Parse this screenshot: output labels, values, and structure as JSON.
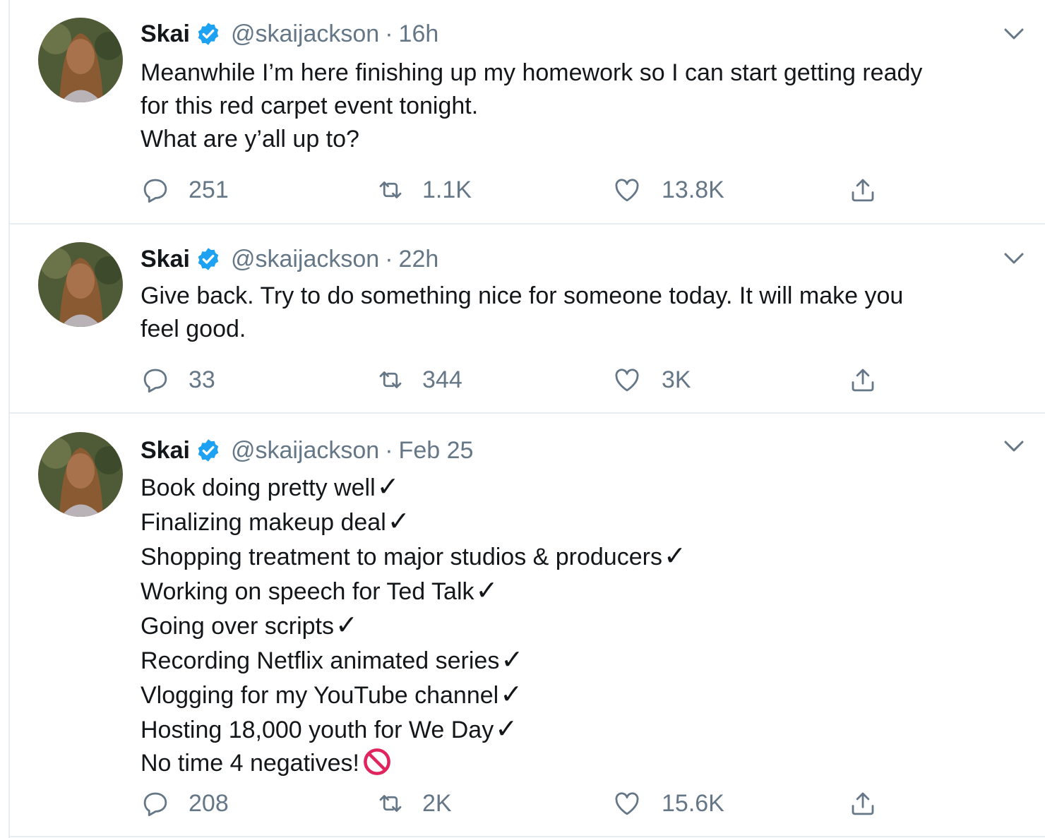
{
  "tweets": [
    {
      "name": "Skai",
      "handle": "@skaijackson",
      "separator": "·",
      "time": "16h",
      "lines": [
        {
          "text": "Meanwhile I’m here finishing up my homework so I can start getting ready"
        },
        {
          "text": "for this red carpet event tonight."
        },
        {
          "text": "What are y’all up to?"
        }
      ],
      "replies": "251",
      "retweets": "1.1K",
      "likes": "13.8K"
    },
    {
      "name": "Skai",
      "handle": "@skaijackson",
      "separator": "·",
      "time": "22h",
      "lines": [
        {
          "text": "Give back. Try to do something nice for someone today. It will make you"
        },
        {
          "text": "feel good."
        }
      ],
      "replies": "33",
      "retweets": "344",
      "likes": "3K"
    },
    {
      "name": "Skai",
      "handle": "@skaijackson",
      "separator": "·",
      "time": "Feb 25",
      "lines": [
        {
          "text": "Book doing pretty well",
          "mark": "✓"
        },
        {
          "text": "Finalizing makeup deal",
          "mark": "✓"
        },
        {
          "text": "Shopping treatment to major studios & producers",
          "mark": "✓"
        },
        {
          "text": "Working on speech for Ted Talk",
          "mark": "✓"
        },
        {
          "text": "Going over scripts",
          "mark": "✓"
        },
        {
          "text": "Recording Netflix animated series",
          "mark": "✓"
        },
        {
          "text": "Vlogging for my YouTube channel",
          "mark": "✓"
        },
        {
          "text": "Hosting 18,000 youth for We Day",
          "mark": "✓"
        },
        {
          "text": "No time 4 negatives!",
          "emoji": "no-entry-sign-icon"
        }
      ],
      "replies": "208",
      "retweets": "2K",
      "likes": "15.6K"
    }
  ],
  "icons": {
    "verified": "verified-badge-icon",
    "caret": "chevron-down-icon",
    "reply": "reply-icon",
    "retweet": "retweet-icon",
    "like": "heart-icon",
    "share": "share-icon"
  },
  "colors": {
    "verified_blue": "#1da1f2",
    "text_primary": "#14171a",
    "text_secondary": "#657786",
    "border": "#e6ecf0",
    "no_entry_red": "#e0245e"
  }
}
